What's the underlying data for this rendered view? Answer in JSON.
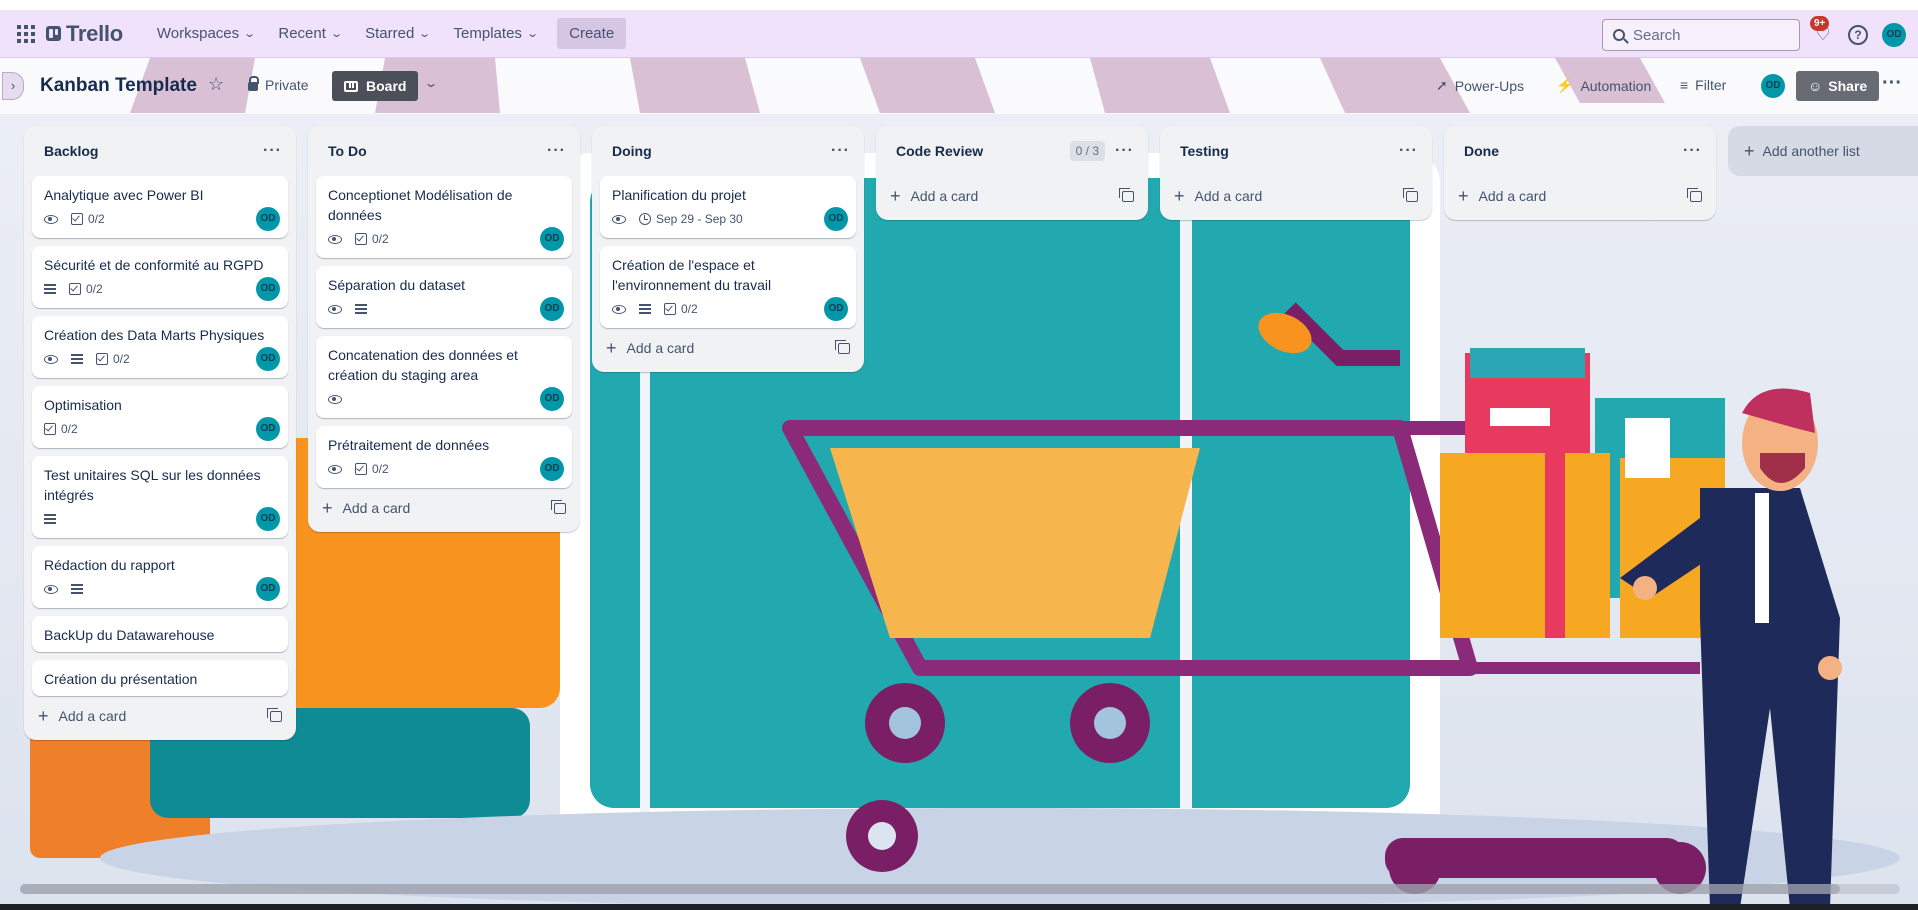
{
  "topbar": {
    "logo": "Trello",
    "nav": [
      {
        "label": "Workspaces"
      },
      {
        "label": "Recent"
      },
      {
        "label": "Starred"
      },
      {
        "label": "Templates"
      }
    ],
    "create_label": "Create",
    "search_placeholder": "Search",
    "notifications_badge": "9+",
    "avatar_initials": "OD"
  },
  "board": {
    "title": "Kanban Template",
    "visibility": "Private",
    "view_label": "Board",
    "powerups_label": "Power-Ups",
    "automation_label": "Automation",
    "filter_label": "Filter",
    "share_label": "Share",
    "avatar_initials": "OD"
  },
  "lists": [
    {
      "title": "Backlog",
      "cards": [
        {
          "title": "Analytique avec Power BI",
          "checklist": "0/2",
          "avatar": "OD"
        },
        {
          "title": "Sécurité et de conformité au RGPD",
          "checklist": "0/2",
          "avatar": "OD"
        },
        {
          "title": "Création des Data Marts Physiques",
          "checklist": "0/2",
          "avatar": "OD"
        },
        {
          "title": "Optimisation",
          "checklist": "0/2",
          "avatar": "OD"
        },
        {
          "title": "Test unitaires SQL sur les données intégrés",
          "avatar": "OD"
        },
        {
          "title": "Rédaction du rapport",
          "avatar": "OD"
        },
        {
          "title": "BackUp du Datawarehouse"
        },
        {
          "title": "Création du présentation"
        }
      ],
      "add_label": "Add a card"
    },
    {
      "title": "To Do",
      "cards": [
        {
          "title": "Conceptionet Modélisation de données",
          "checklist": "0/2",
          "avatar": "OD"
        },
        {
          "title": "Séparation du dataset",
          "avatar": "OD"
        },
        {
          "title": "Concatenation des données et création du staging area",
          "avatar": "OD"
        },
        {
          "title": "Prétraitement de données",
          "checklist": "0/2",
          "avatar": "OD"
        }
      ],
      "add_label": "Add a card"
    },
    {
      "title": "Doing",
      "cards": [
        {
          "title": "Planification du projet",
          "dates": "Sep 29 - Sep 30",
          "avatar": "OD"
        },
        {
          "title": "Création de l'espace et l'environnement du travail",
          "checklist": "0/2",
          "avatar": "OD"
        }
      ],
      "add_label": "Add a card"
    },
    {
      "title": "Code Review",
      "limit": "0 / 3",
      "add_label": "Add a card"
    },
    {
      "title": "Testing",
      "add_label": "Add a card"
    },
    {
      "title": "Done",
      "add_label": "Add a card"
    }
  ],
  "add_list_label": "Add another list",
  "colors": {
    "topbar": "#f0e2fb",
    "avatar": "#0098a8",
    "badge": "#c9372c",
    "board_button": "#4a4f58"
  }
}
